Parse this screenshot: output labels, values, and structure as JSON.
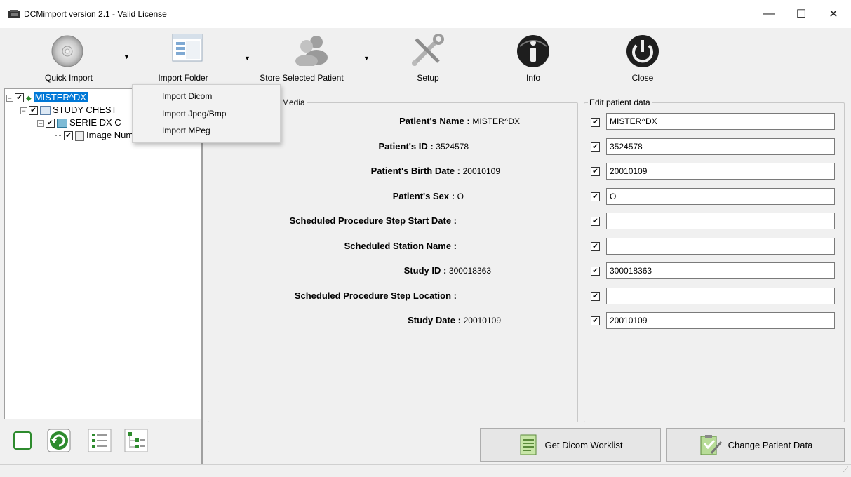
{
  "window": {
    "title": "DCMimport version 2.1 - Valid License",
    "minimize_glyph": "—",
    "maximize_glyph": "☐",
    "close_glyph": "✕"
  },
  "toolbar": {
    "quick_import": "Quick Import",
    "import_folder": "Import Folder",
    "store_selected_patient": "Store Selected Patient",
    "setup": "Setup",
    "info": "Info",
    "close": "Close"
  },
  "import_menu": {
    "items": [
      "Import Dicom",
      "Import Jpeg/Bmp",
      "Import MPeg"
    ]
  },
  "tree": {
    "patient": "MISTER^DX",
    "study": "STUDY CHEST",
    "serie": "SERIE DX C",
    "image": "Image Number 1"
  },
  "media_panel": {
    "title": "n Media",
    "rows": [
      {
        "label": "Patient's Name",
        "value": "MISTER^DX"
      },
      {
        "label": "Patient's ID",
        "value": "3524578"
      },
      {
        "label": "Patient's Birth Date",
        "value": "20010109"
      },
      {
        "label": "Patient's Sex",
        "value": "O"
      },
      {
        "label": "Scheduled Procedure Step Start Date",
        "value": ""
      },
      {
        "label": "Scheduled Station Name",
        "value": ""
      },
      {
        "label": "Study ID",
        "value": "300018363"
      },
      {
        "label": "Scheduled Procedure Step Location",
        "value": ""
      },
      {
        "label": "Study Date",
        "value": "20010109"
      }
    ]
  },
  "edit_panel": {
    "title": "Edit patient data",
    "fields": [
      "MISTER^DX",
      "3524578",
      "20010109",
      "O",
      "",
      "",
      "300018363",
      "",
      "20010109"
    ]
  },
  "buttons": {
    "get_worklist": "Get Dicom Worklist",
    "change_patient_data": "Change Patient Data"
  },
  "colors": {
    "selection": "#0078d7",
    "tree_checkbox": "#000000",
    "green_icon": "#2e8b2e"
  }
}
